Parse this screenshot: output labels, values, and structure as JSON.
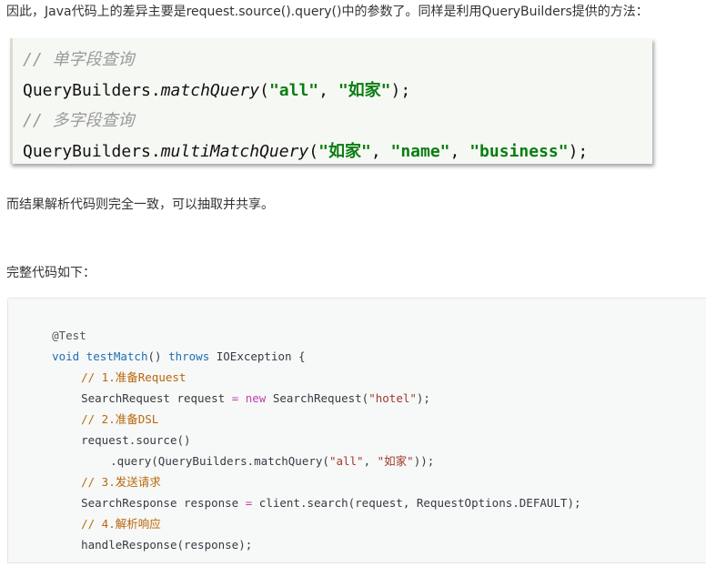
{
  "paragraphs": {
    "intro": "因此，Java代码上的差异主要是request.source().query()中的参数了。同样是利用QueryBuilders提供的方法：",
    "consistent": "而结果解析代码则完全一致，可以抽取并共享。",
    "full_code_intro": "完整代码如下："
  },
  "snippet": {
    "line1_comment": "// 单字段查询",
    "line2_class": "QueryBuilders.",
    "line2_method": "matchQuery",
    "line2_open": "(",
    "line2_arg1": "\"all\"",
    "line2_sep": ", ",
    "line2_arg2": "\"如家\"",
    "line2_close": ");",
    "line3_comment": "// 多字段查询",
    "line4_class": "QueryBuilders.",
    "line4_method": "multiMatchQuery",
    "line4_open": "(",
    "line4_arg1": "\"如家\"",
    "line4_sep1": ", ",
    "line4_arg2": "\"name\"",
    "line4_sep2": ", ",
    "line4_arg3": "\"business\"",
    "line4_close": ");"
  },
  "code": {
    "l1_anno": "@Test",
    "l2_void": "void",
    "l2_fn": "testMatch",
    "l2_parens": "() ",
    "l2_throws": "throws",
    "l2_rest": " IOException {",
    "l3_comment": "// 1.准备Request",
    "l4_a": "SearchRequest request ",
    "l4_eq": "=",
    "l4_sp": " ",
    "l4_new": "new",
    "l4_b": " SearchRequest(",
    "l4_str": "\"hotel\"",
    "l4_c": ");",
    "l5_comment": "// 2.准备DSL",
    "l6": "request.source()",
    "l7_a": ".query(QueryBuilders.matchQuery(",
    "l7_str1": "\"all\"",
    "l7_sep": ", ",
    "l7_str2": "\"如家\"",
    "l7_b": "));",
    "l8_comment": "// 3.发送请求",
    "l9_a": "SearchResponse response ",
    "l9_eq": "=",
    "l9_b": " client.search(request, RequestOptions.DEFAULT);",
    "l10_comment": "// 4.解析响应",
    "l11": "handleResponse(response);"
  }
}
